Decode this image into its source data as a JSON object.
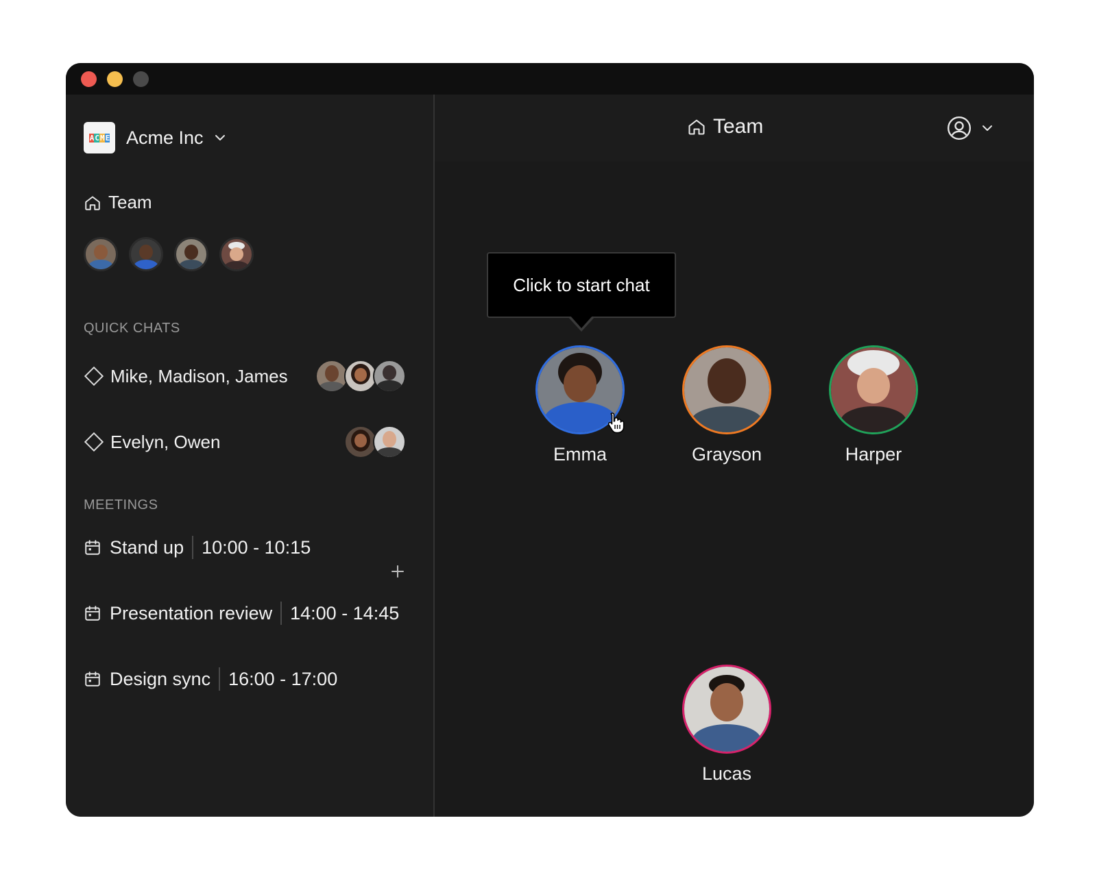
{
  "org": {
    "name": "Acme Inc",
    "logo_letters": [
      "A",
      "C",
      "M",
      "E"
    ],
    "logo_colors": [
      "#e9513d",
      "#2db5a3",
      "#f4b63f",
      "#3b8fd9"
    ]
  },
  "sidebar": {
    "team_label": "Team",
    "quick_chats_heading": "QUICK CHATS",
    "quick_chats": [
      {
        "label": "Mike, Madison, James"
      },
      {
        "label": "Evelyn, Owen"
      }
    ],
    "meetings_heading": "MEETINGS",
    "meetings": [
      {
        "name": "Stand up",
        "time": "10:00 - 10:15"
      },
      {
        "name": "Presentation review",
        "time": "14:00 - 14:45"
      },
      {
        "name": "Design sync",
        "time": "16:00 - 17:00"
      }
    ]
  },
  "header": {
    "title": "Team"
  },
  "tooltip": {
    "text": "Click to start chat"
  },
  "members": [
    {
      "name": "Emma",
      "ring": "#2f6de1"
    },
    {
      "name": "Grayson",
      "ring": "#f07a22"
    },
    {
      "name": "Harper",
      "ring": "#1fa35a"
    },
    {
      "name": "Lucas",
      "ring": "#d8216b"
    }
  ],
  "colors": {
    "window_bg": "#1b1b1b",
    "titlebar": "#0f0f0f",
    "text": "#f2f2f2",
    "muted": "#9a9a9a"
  },
  "icons": {
    "home": "home-icon",
    "diamond": "diamond-icon",
    "calendar": "calendar-icon",
    "plus": "plus-icon",
    "user": "user-circle-icon",
    "chevron": "chevron-down-icon",
    "cursor": "hand-cursor-icon"
  }
}
